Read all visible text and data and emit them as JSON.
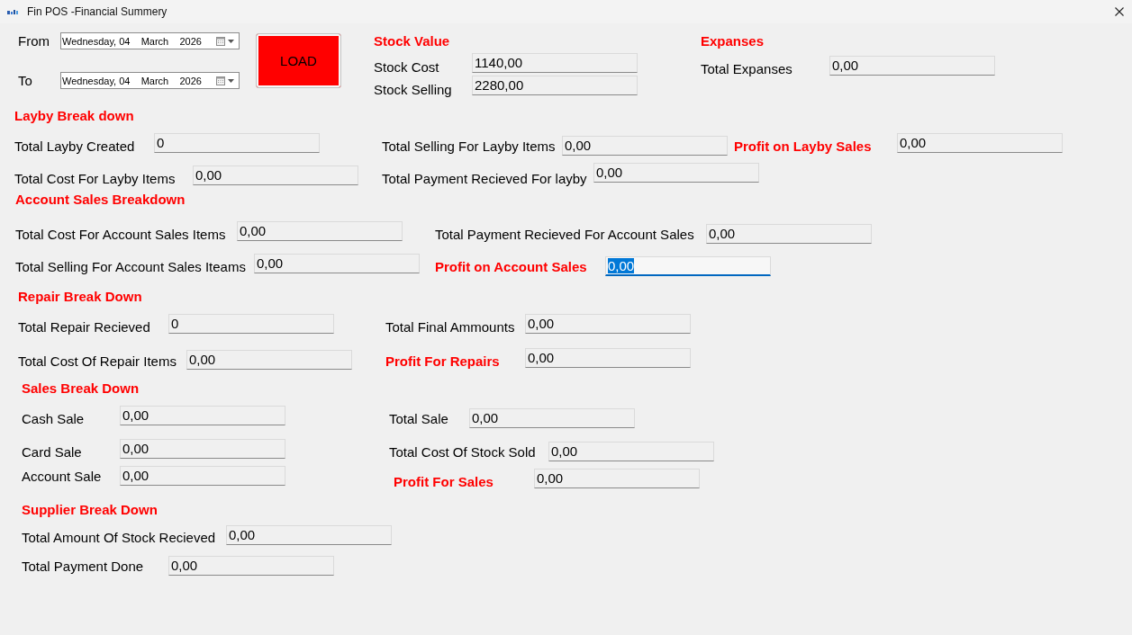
{
  "window": {
    "title": "Fin POS -Financial Summery"
  },
  "date_range": [
    {
      "label": "From",
      "value": "Wednesday, 04    March    2026"
    },
    {
      "label": "To",
      "value": "Wednesday, 04    March    2026"
    }
  ],
  "load_button": "LOAD",
  "stock_value": {
    "heading": "Stock Value",
    "fields": [
      {
        "label": "Stock Cost",
        "value": "1140,00",
        "kind": "plain",
        "focused": false
      },
      {
        "label": "Stock Selling",
        "value": "2280,00",
        "kind": "plain",
        "focused": false
      }
    ]
  },
  "expanses": {
    "heading": "Expanses",
    "fields": [
      {
        "label": "Total Expanses",
        "value": "0,00",
        "kind": "plain",
        "focused": false
      }
    ]
  },
  "sections": [
    {
      "heading": "Layby Break down",
      "rows": [
        {
          "fields": [
            {
              "label": "Total Layby Created",
              "value": "0",
              "kind": "plain",
              "focused": false
            },
            {
              "label": "Total Selling For Layby Items",
              "value": "0,00",
              "kind": "plain",
              "focused": false
            },
            {
              "label": "Profit on Layby Sales",
              "value": "0,00",
              "kind": "profit",
              "focused": false
            }
          ]
        },
        {
          "fields": [
            {
              "label": "Total Cost For Layby Items",
              "value": "0,00",
              "kind": "plain",
              "focused": false
            },
            {
              "label": "Total Payment Recieved For layby",
              "value": "0,00",
              "kind": "plain",
              "focused": false
            }
          ]
        }
      ]
    },
    {
      "heading": "Account Sales Breakdown",
      "rows": [
        {
          "fields": [
            {
              "label": "Total Cost For Account Sales Items",
              "value": "0,00",
              "kind": "plain",
              "focused": false
            },
            {
              "label": "Total Payment Recieved For Account Sales",
              "value": "0,00",
              "kind": "plain",
              "focused": false
            }
          ]
        },
        {
          "fields": [
            {
              "label": "Total Selling For Account Sales Iteams",
              "value": "0,00",
              "kind": "plain",
              "focused": false
            },
            {
              "label": "Profit on Account Sales",
              "value": "0,00",
              "kind": "profit",
              "focused": true
            }
          ]
        }
      ]
    },
    {
      "heading": "Repair Break Down",
      "rows": [
        {
          "fields": [
            {
              "label": "Total Repair Recieved",
              "value": "0",
              "kind": "plain",
              "focused": false
            },
            {
              "label": "Total Final Ammounts",
              "value": "0,00",
              "kind": "plain",
              "focused": false
            }
          ]
        },
        {
          "fields": [
            {
              "label": "Total Cost Of Repair Items",
              "value": "0,00",
              "kind": "plain",
              "focused": false
            },
            {
              "label": "Profit For Repairs",
              "value": "0,00",
              "kind": "profit",
              "focused": false
            }
          ]
        }
      ]
    },
    {
      "heading": "Sales Break Down",
      "rows": [
        {
          "fields": [
            {
              "label": "Cash Sale",
              "value": "0,00",
              "kind": "plain",
              "focused": false
            },
            {
              "label": "Total Sale",
              "value": "0,00",
              "kind": "plain",
              "focused": false
            }
          ]
        },
        {
          "fields": [
            {
              "label": "Card Sale",
              "value": "0,00",
              "kind": "plain",
              "focused": false
            },
            {
              "label": "Total Cost Of Stock Sold",
              "value": "0,00",
              "kind": "plain",
              "focused": false
            }
          ]
        },
        {
          "fields": [
            {
              "label": "Account Sale",
              "value": "0,00",
              "kind": "plain",
              "focused": false
            },
            {
              "label": "Profit For Sales",
              "value": "0,00",
              "kind": "profit",
              "focused": false
            }
          ]
        }
      ]
    },
    {
      "heading": "Supplier Break Down",
      "rows": [
        {
          "fields": [
            {
              "label": "Total Amount Of Stock Recieved",
              "value": "0,00",
              "kind": "plain",
              "focused": false
            }
          ]
        },
        {
          "fields": [
            {
              "label": "Total Payment Done",
              "value": "0,00",
              "kind": "plain",
              "focused": false
            }
          ]
        }
      ]
    }
  ]
}
